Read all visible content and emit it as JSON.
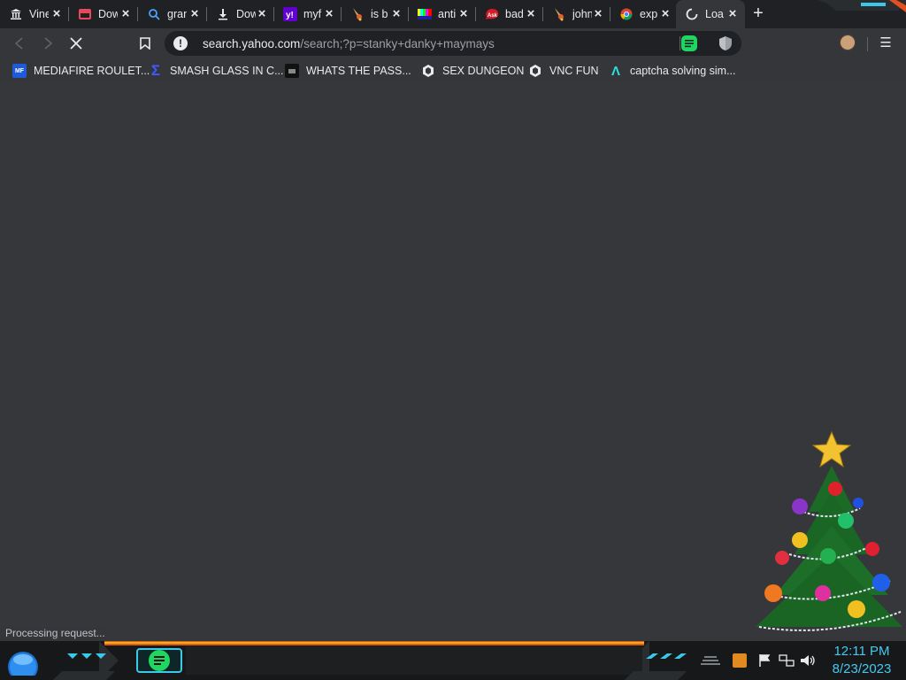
{
  "tabs": [
    {
      "title": "Vine",
      "icon": "museum-icon",
      "active": false
    },
    {
      "title": "Dow",
      "icon": "store-icon",
      "active": false
    },
    {
      "title": "gran",
      "icon": "search-icon",
      "active": false
    },
    {
      "title": "Dow",
      "icon": "download-icon",
      "active": false
    },
    {
      "title": "myf",
      "icon": "yahoo-icon",
      "active": false
    },
    {
      "title": "is b",
      "icon": "rocket-icon",
      "active": false
    },
    {
      "title": "anti",
      "icon": "color-bars-icon",
      "active": false
    },
    {
      "title": "bad",
      "icon": "ask-icon",
      "active": false
    },
    {
      "title": "john",
      "icon": "rocket-icon",
      "active": false
    },
    {
      "title": "exp",
      "icon": "chrome-icon",
      "active": false
    },
    {
      "title": "Loa",
      "icon": "loading-spinner-icon",
      "active": true
    }
  ],
  "toolbar": {
    "url_host": "search.yahoo.com",
    "url_path": "/search;?p=stanky+danky+maymays"
  },
  "bookmarks": [
    {
      "label": "MEDIAFIRE ROULET...",
      "icon": "mediafire-icon",
      "icon_text": "MF"
    },
    {
      "label": "SMASH GLASS IN C...",
      "icon": "sigma-icon",
      "icon_text": "Σ"
    },
    {
      "label": "WHATS THE PASS...",
      "icon": "dark-square-icon",
      "icon_text": ""
    },
    {
      "label": "SEX DUNGEON",
      "icon": "globe-icon",
      "icon_text": ""
    },
    {
      "label": "VNC FUN",
      "icon": "globe-icon",
      "icon_text": ""
    },
    {
      "label": "captcha solving sim...",
      "icon": "lambda-icon",
      "icon_text": "Λ"
    }
  ],
  "status_text": "Processing request...",
  "clock": {
    "time": "12:11 PM",
    "date": "8/23/2023"
  },
  "colors": {
    "tabstrip": "#202124",
    "toolbar": "#35363a",
    "accent_cyan": "#48c8f0",
    "spotify_green": "#1ed760"
  }
}
